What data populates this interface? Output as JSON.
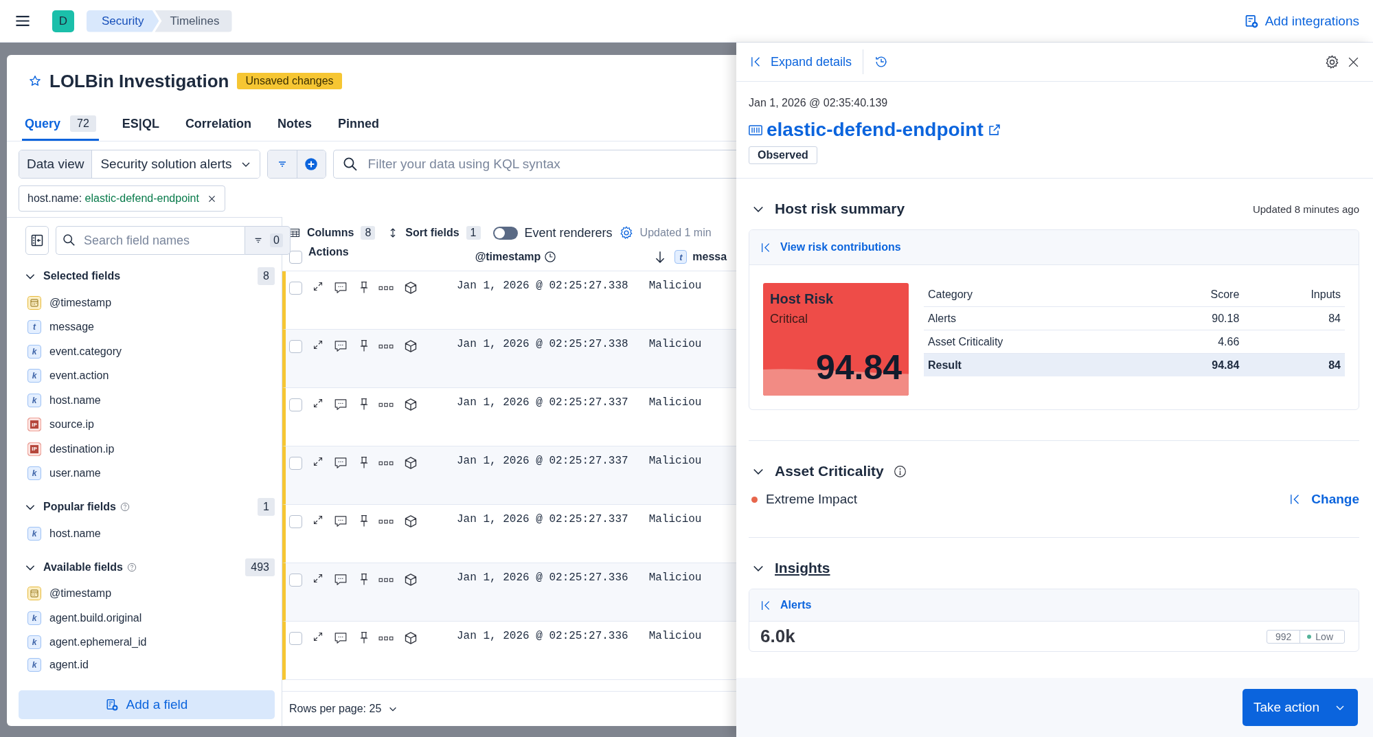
{
  "header": {
    "logo": "D",
    "breadcrumbs": [
      "Security",
      "Timelines"
    ],
    "add_integrations": "Add integrations"
  },
  "timeline": {
    "title": "LOLBin Investigation",
    "favorite": false,
    "badge": "Unsaved changes",
    "tabs": [
      {
        "label": "Query",
        "count": "72",
        "selected": true
      },
      {
        "label": "ES|QL",
        "selected": false
      },
      {
        "label": "Correlation",
        "selected": false
      },
      {
        "label": "Notes",
        "selected": false
      },
      {
        "label": "Pinned",
        "selected": false
      }
    ],
    "data_view": {
      "label": "Data view",
      "value": "Security solution alerts"
    },
    "query": {
      "placeholder": "Filter your data using KQL syntax"
    },
    "filters": [
      {
        "field": "host.name:",
        "value": "elastic-defend-endpoint"
      }
    ],
    "field_search": {
      "placeholder": "Search field names",
      "filter_count": "0"
    },
    "field_groups": [
      {
        "title": "Selected fields",
        "count": "8",
        "help": false,
        "expanded": true,
        "fields": [
          {
            "name": "@timestamp",
            "kind": "date"
          },
          {
            "name": "message",
            "kind": "text",
            "type": "t"
          },
          {
            "name": "event.category",
            "kind": "keyword",
            "type": "k"
          },
          {
            "name": "event.action",
            "kind": "keyword",
            "type": "k"
          },
          {
            "name": "host.name",
            "kind": "keyword",
            "type": "k"
          },
          {
            "name": "source.ip",
            "kind": "ip",
            "type": "IP"
          },
          {
            "name": "destination.ip",
            "kind": "ip",
            "type": "IP"
          },
          {
            "name": "user.name",
            "kind": "keyword",
            "type": "k"
          }
        ]
      },
      {
        "title": "Popular fields",
        "count": "1",
        "help": true,
        "expanded": true,
        "fields": [
          {
            "name": "host.name",
            "kind": "keyword",
            "type": "k"
          }
        ]
      },
      {
        "title": "Available fields",
        "count": "493",
        "help": true,
        "expanded": true,
        "fields": [
          {
            "name": "@timestamp",
            "kind": "date"
          },
          {
            "name": "agent.build.original",
            "kind": "keyword",
            "type": "k"
          },
          {
            "name": "agent.ephemeral_id",
            "kind": "keyword",
            "type": "k"
          },
          {
            "name": "agent.id",
            "kind": "keyword",
            "type": "k"
          }
        ]
      }
    ],
    "add_field": "Add a field",
    "toolbar": {
      "columns": "Columns",
      "columns_count": "8",
      "sort": "Sort fields",
      "sort_count": "1",
      "renderers": {
        "label": "Event renderers",
        "on": false
      },
      "updated": "Updated 1 min"
    },
    "table": {
      "columns": [
        "Actions",
        "@timestamp",
        "messa"
      ],
      "message_type": "t",
      "all_checked": false,
      "rows": [
        {
          "checked": false,
          "timestamp": "Jan 1, 2026 @ 02:25:27.338",
          "message": "Maliciou"
        },
        {
          "checked": false,
          "timestamp": "Jan 1, 2026 @ 02:25:27.338",
          "message": "Maliciou"
        },
        {
          "checked": false,
          "timestamp": "Jan 1, 2026 @ 02:25:27.337",
          "message": "Maliciou"
        },
        {
          "checked": false,
          "timestamp": "Jan 1, 2026 @ 02:25:27.337",
          "message": "Maliciou"
        },
        {
          "checked": false,
          "timestamp": "Jan 1, 2026 @ 02:25:27.337",
          "message": "Maliciou"
        },
        {
          "checked": false,
          "timestamp": "Jan 1, 2026 @ 02:25:27.336",
          "message": "Maliciou"
        },
        {
          "checked": false,
          "timestamp": "Jan 1, 2026 @ 02:25:27.336",
          "message": "Maliciou"
        }
      ]
    },
    "rows_per_page": "Rows per page: 25"
  },
  "flyout": {
    "expand": "Expand details",
    "timestamp": "Jan 1, 2026 @ 02:35:40.139",
    "host": "elastic-defend-endpoint",
    "badge": "Observed",
    "risk": {
      "title": "Host risk summary",
      "expanded": true,
      "updated": "Updated 8 minutes ago",
      "link": "View risk contributions",
      "tile": {
        "title": "Host Risk",
        "level_label": "Critical",
        "score": "94.84"
      },
      "columns": [
        "Category",
        "Score",
        "Inputs"
      ],
      "rows": [
        {
          "category": "Alerts",
          "score": "90.18",
          "inputs": "84",
          "kind": "item"
        },
        {
          "category": "Asset Criticality",
          "score": "4.66",
          "kind": "item"
        },
        {
          "category": "Result",
          "score": "94.84",
          "inputs": "84",
          "kind": "total"
        }
      ]
    },
    "criticality": {
      "title": "Asset Criticality",
      "expanded": true,
      "level": {
        "label": "Extreme Impact",
        "color": "#e7664c"
      },
      "action": "Change"
    },
    "insights": {
      "title": "Insights",
      "expanded": true,
      "link": "Alerts",
      "total": "6.0k",
      "count": "992",
      "severity": {
        "label": "Low",
        "color": "#54b399"
      }
    },
    "take_action": "Take action"
  }
}
